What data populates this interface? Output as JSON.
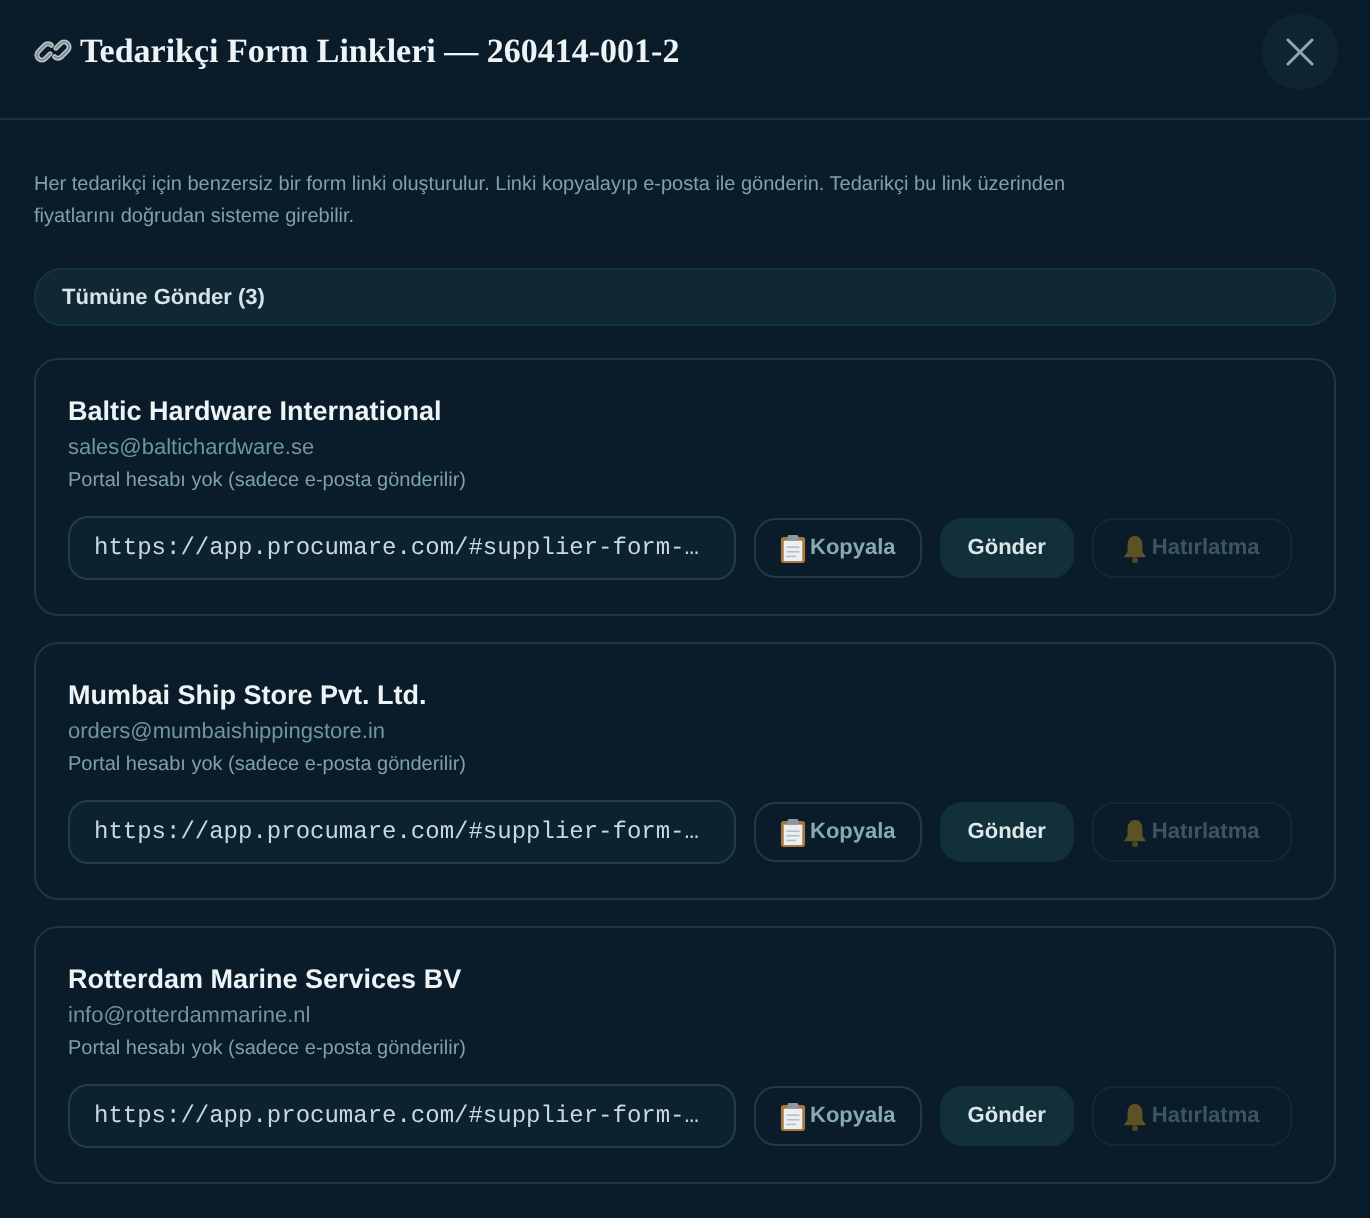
{
  "dialog": {
    "title": "Tedarikçi Form Linkleri — 260414-001-2",
    "description": "Her tedarikçi için benzersiz bir form linki oluşturulur. Linki kopyalayıp e-posta ile gönderin. Tedarikçi bu link üzerinden fiyatlarını doğrudan sisteme girebilir.",
    "send_all_button": "Tümüne Gönder (3)"
  },
  "suppliers": [
    {
      "name": "Baltic Hardware International",
      "email": "sales@baltichardware.se",
      "note": "Portal hesabı yok (sadece e-posta gönderilir)",
      "link": "https://app.procumare.com/#supplier-form-…",
      "buttons": [
        {
          "kind": "copy",
          "label": "Kopyala",
          "disabled": false
        },
        {
          "kind": "send",
          "label": "Gönder",
          "disabled": false
        },
        {
          "kind": "remind",
          "label": "Hatırlatma",
          "disabled": true
        }
      ]
    },
    {
      "name": "Mumbai Ship Store Pvt. Ltd.",
      "email": "orders@mumbaishippingstore.in",
      "note": "Portal hesabı yok (sadece e-posta gönderilir)",
      "link": "https://app.procumare.com/#supplier-form-…",
      "buttons": [
        {
          "kind": "copy",
          "label": "Kopyala",
          "disabled": false
        },
        {
          "kind": "send",
          "label": "Gönder",
          "disabled": false
        },
        {
          "kind": "remind",
          "label": "Hatırlatma",
          "disabled": true
        }
      ]
    },
    {
      "name": "Rotterdam Marine Services BV",
      "email": "info@rotterdammarine.nl",
      "note": "Portal hesabı yok (sadece e-posta gönderilir)",
      "link": "https://app.procumare.com/#supplier-form-…",
      "buttons": [
        {
          "kind": "copy",
          "label": "Kopyala",
          "disabled": false
        },
        {
          "kind": "send",
          "label": "Gönder",
          "disabled": false
        },
        {
          "kind": "remind",
          "label": "Hatırlatma",
          "disabled": true
        }
      ]
    }
  ]
}
